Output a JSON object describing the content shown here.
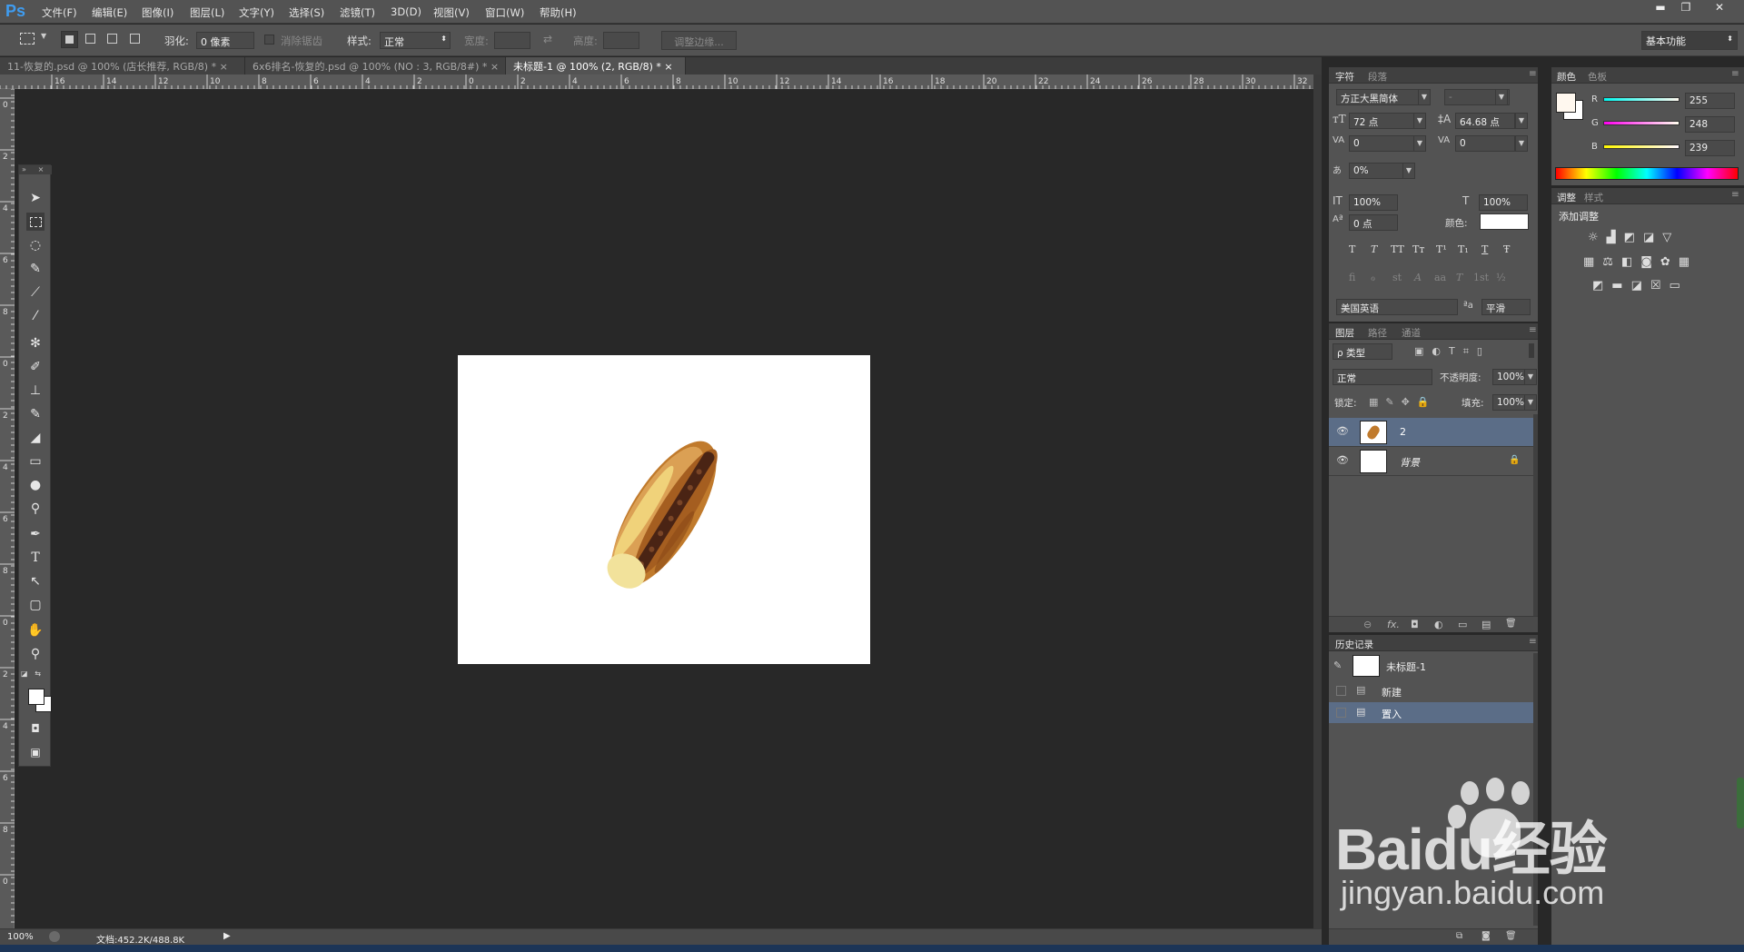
{
  "app": {
    "logo": "Ps",
    "workspace": "基本功能"
  },
  "menu": [
    "文件(F)",
    "编辑(E)",
    "图像(I)",
    "图层(L)",
    "文字(Y)",
    "选择(S)",
    "滤镜(T)",
    "3D(D)",
    "视图(V)",
    "窗口(W)",
    "帮助(H)"
  ],
  "window_controls": {
    "minimize": "▬",
    "restore": "❐",
    "close": "✕"
  },
  "options": {
    "feather_label": "羽化:",
    "feather_value": "0 像素",
    "antialias_label": "消除锯齿",
    "style_label": "样式:",
    "style_value": "正常",
    "width_label": "宽度:",
    "height_label": "高度:",
    "refine_edge": "调整边缘..."
  },
  "tabs": [
    {
      "label": "11-恢复的.psd @ 100% (店长推荐, RGB/8) *"
    },
    {
      "label": "6x6排名-恢复的.psd @ 100% (NO : 3, RGB/8#) *"
    },
    {
      "label": "未标题-1 @ 100% (2, RGB/8) *"
    }
  ],
  "ruler_top": [
    "16",
    "14",
    "12",
    "10",
    "8",
    "6",
    "4",
    "2",
    "0",
    "2",
    "4",
    "6",
    "8",
    "10",
    "12",
    "14",
    "16",
    "18",
    "20",
    "22",
    "24",
    "26",
    "28",
    "30",
    "32"
  ],
  "ruler_left": [
    "0",
    "2",
    "4",
    "6",
    "8",
    "0",
    "2",
    "4",
    "6",
    "8",
    "0",
    "2",
    "4",
    "6",
    "8",
    "0"
  ],
  "status": {
    "zoom": "100%",
    "doc": "文档:452.2K/488.8K"
  },
  "character": {
    "tabs": [
      "字符",
      "段落"
    ],
    "font": "方正大黑简体",
    "style": "-",
    "size": "72 点",
    "leading": "64.68 点",
    "kerning": "0",
    "tracking": "0",
    "scale_pct": "0%",
    "vscale": "100%",
    "hscale": "100%",
    "baseline": "0 点",
    "color_label": "颜色:",
    "type_buttons": [
      "T",
      "T",
      "TT",
      "Tт",
      "T¹",
      "T₁",
      "T",
      "Ŧ"
    ],
    "ot_buttons": [
      "fi",
      "ℴ",
      "st",
      "A",
      "aa",
      "T",
      "1st",
      "½"
    ],
    "language": "美国英语",
    "aa_label": "ªa",
    "antialias": "平滑"
  },
  "color": {
    "tabs": [
      "颜色",
      "色板"
    ],
    "r_label": "R",
    "g_label": "G",
    "b_label": "B",
    "r": "255",
    "g": "248",
    "b": "239",
    "fg": "#fff8ef"
  },
  "adjustments": {
    "tabs": [
      "调整",
      "样式"
    ],
    "title": "添加调整"
  },
  "layers": {
    "tabs": [
      "图层",
      "路径",
      "通道"
    ],
    "filter": "ρ 类型",
    "blend": "正常",
    "opacity_label": "不透明度:",
    "opacity": "100%",
    "lock_label": "锁定:",
    "fill_label": "填充:",
    "fill": "100%",
    "items": [
      {
        "name": "2"
      },
      {
        "name": "背景"
      }
    ],
    "footer_icons": [
      "⊖",
      "fx.",
      "◘",
      "◐",
      "▭",
      "▤",
      "🗑"
    ]
  },
  "history": {
    "tab": "历史记录",
    "snapshot": "未标题-1",
    "items": [
      {
        "name": "新建"
      },
      {
        "name": "置入"
      }
    ]
  },
  "watermark": {
    "brand": "Baidu经验",
    "url": "jingyan.baidu.com"
  }
}
